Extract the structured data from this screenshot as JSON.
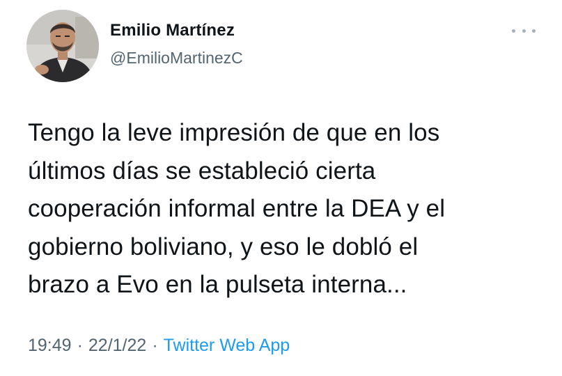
{
  "author": {
    "name": "Emilio Martínez",
    "handle": "@EmilioMartinezC"
  },
  "tweet": {
    "lines": [
      "Tengo la leve impresión de que en los",
      "últimos días se estableció cierta",
      "cooperación informal entre la DEA y el",
      "gobierno boliviano, y eso le dobló el",
      "brazo a Evo en la pulseta interna..."
    ]
  },
  "meta": {
    "time": "19:49",
    "date": "22/1/22",
    "separator": "·",
    "source": "Twitter Web App"
  },
  "icons": {
    "more": "more-options-icon"
  },
  "colors": {
    "text": "#0f1419",
    "secondary": "#536471",
    "link": "#1d9bf0"
  }
}
